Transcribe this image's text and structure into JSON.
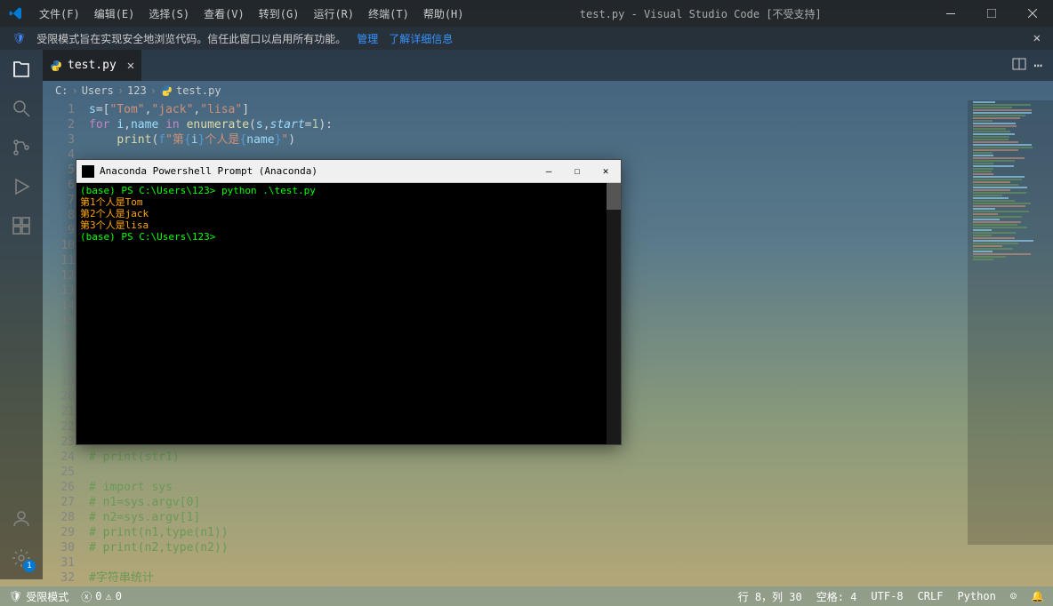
{
  "titlebar": {
    "menus": [
      "文件(F)",
      "编辑(E)",
      "选择(S)",
      "查看(V)",
      "转到(G)",
      "运行(R)",
      "终端(T)",
      "帮助(H)"
    ],
    "title": "test.py - Visual Studio Code [不受支持]"
  },
  "restricted": {
    "message": "受限模式旨在实现安全地浏览代码。信任此窗口以启用所有功能。",
    "manage": "管理",
    "learn_more": "了解详细信息"
  },
  "tab": {
    "filename": "test.py"
  },
  "breadcrumb": {
    "parts": [
      "C:",
      "Users",
      "123",
      "test.py"
    ]
  },
  "code_lines": [
    {
      "n": 1,
      "html": "<span class='var'>s</span><span class='punc'>=[</span><span class='str'>\"Tom\"</span><span class='punc'>,</span><span class='str'>\"jack\"</span><span class='punc'>,</span><span class='str'>\"lisa\"</span><span class='punc'>]</span>"
    },
    {
      "n": 2,
      "html": "<span class='kw'>for</span> <span class='var'>i</span><span class='punc'>,</span><span class='var'>name</span> <span class='kw'>in</span> <span class='fn'>enumerate</span><span class='punc'>(</span><span class='var'>s</span><span class='punc'>,</span><span class='param'>start</span><span class='punc'>=</span><span class='num'>1</span><span class='punc'>):</span>"
    },
    {
      "n": 3,
      "html": "    <span class='fn'>print</span><span class='punc'>(</span><span class='kw2'>f</span><span class='str'>\"第</span><span class='escape'>{</span><span class='var'>i</span><span class='escape'>}</span><span class='str'>个人是</span><span class='escape'>{</span><span class='var'>name</span><span class='escape'>}</span><span class='str'>\"</span><span class='punc'>)</span>"
    },
    {
      "n": 4,
      "html": ""
    },
    {
      "n": 5,
      "html": ""
    },
    {
      "n": 6,
      "html": ""
    },
    {
      "n": 7,
      "html": ""
    },
    {
      "n": 8,
      "html": ""
    },
    {
      "n": 9,
      "html": ""
    },
    {
      "n": 10,
      "html": ""
    },
    {
      "n": 11,
      "html": ""
    },
    {
      "n": 12,
      "html": ""
    },
    {
      "n": 13,
      "html": ""
    },
    {
      "n": 14,
      "html": ""
    },
    {
      "n": 15,
      "html": ""
    },
    {
      "n": 16,
      "html": ""
    },
    {
      "n": 17,
      "html": ""
    },
    {
      "n": 18,
      "html": ""
    },
    {
      "n": 19,
      "html": ""
    },
    {
      "n": 20,
      "html": ""
    },
    {
      "n": 21,
      "html": ""
    },
    {
      "n": 22,
      "html": ""
    },
    {
      "n": 23,
      "html": ""
    },
    {
      "n": 24,
      "html": "<span class='cmt'># print(str1)</span>"
    },
    {
      "n": 25,
      "html": ""
    },
    {
      "n": 26,
      "html": "<span class='cmt'># import sys</span>"
    },
    {
      "n": 27,
      "html": "<span class='cmt'># n1=sys.argv[0]</span>"
    },
    {
      "n": 28,
      "html": "<span class='cmt'># n2=sys.argv[1]</span>"
    },
    {
      "n": 29,
      "html": "<span class='cmt'># print(n1,type(n1))</span>"
    },
    {
      "n": 30,
      "html": "<span class='cmt'># print(n2,type(n2))</span>"
    },
    {
      "n": 31,
      "html": ""
    },
    {
      "n": 32,
      "html": "<span class='cmt'>#字符串统计</span>"
    }
  ],
  "terminal": {
    "title": "Anaconda Powershell Prompt (Anaconda)",
    "lines": [
      {
        "cls": "prompt",
        "text": "(base) PS C:\\Users\\123> python .\\test.py"
      },
      {
        "cls": "out",
        "text": "第1个人是Tom"
      },
      {
        "cls": "out",
        "text": "第2个人是jack"
      },
      {
        "cls": "out",
        "text": "第3个人是lisa"
      },
      {
        "cls": "prompt",
        "text": "(base) PS C:\\Users\\123>"
      }
    ]
  },
  "statusbar": {
    "restricted": "受限模式",
    "errors": "0",
    "warnings": "0",
    "ln_col": "行 8，列 30",
    "spaces": "空格: 4",
    "encoding": "UTF-8",
    "eol": "CRLF",
    "lang": "Python"
  },
  "gear_badge": "1"
}
